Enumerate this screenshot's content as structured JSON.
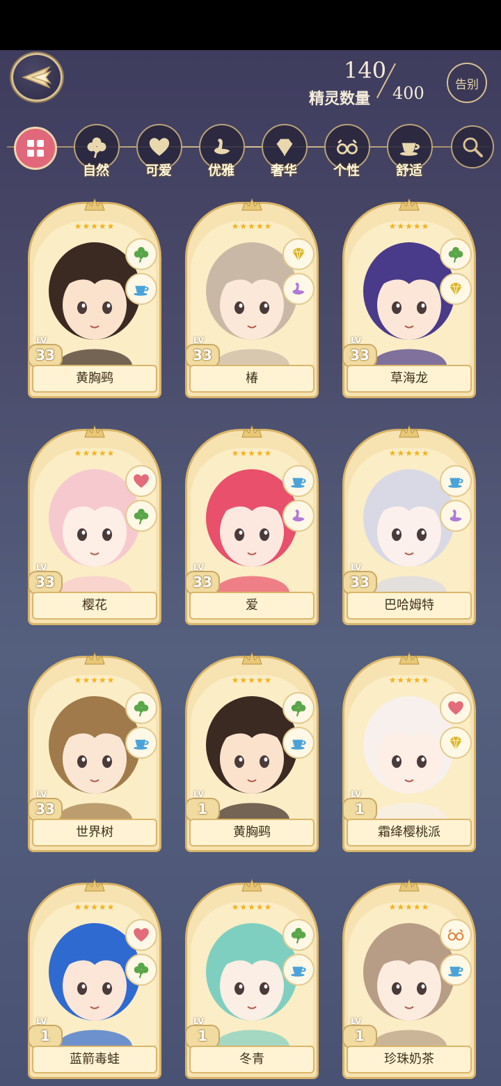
{
  "header": {
    "count_current": "140",
    "count_label": "精灵数量",
    "count_max": "400",
    "farewell_label": "告别"
  },
  "filters": [
    {
      "label": "自然",
      "icon": "clover-icon"
    },
    {
      "label": "可爱",
      "icon": "heart-icon"
    },
    {
      "label": "优雅",
      "icon": "swan-icon"
    },
    {
      "label": "奢华",
      "icon": "diamond-icon"
    },
    {
      "label": "个性",
      "icon": "glasses-icon"
    },
    {
      "label": "舒适",
      "icon": "teacup-icon"
    }
  ],
  "colors": {
    "clover": "#5aa64a",
    "heart": "#e36b7a",
    "swan": "#b07ad8",
    "diamond": "#d9b42a",
    "teacup": "#4aa3d8",
    "glasses": "#d98a4a"
  },
  "cards": [
    {
      "name": "黄胸鹀",
      "lv_label": "LV",
      "level": "33",
      "badges": [
        "clover-icon",
        "teacup-icon"
      ],
      "hair": "#3a2a22",
      "skin": "#fbe2cc"
    },
    {
      "name": "椿",
      "lv_label": "LV",
      "level": "33",
      "badges": [
        "diamond-icon",
        "swan-icon"
      ],
      "hair": "#c9b8a6",
      "skin": "#fbe8d8"
    },
    {
      "name": "草海龙",
      "lv_label": "LV",
      "level": "33",
      "badges": [
        "clover-icon",
        "diamond-icon"
      ],
      "hair": "#4a3a8a",
      "skin": "#fbe6d8"
    },
    {
      "name": "樱花",
      "lv_label": "LV",
      "level": "33",
      "badges": [
        "heart-icon",
        "clover-icon"
      ],
      "hair": "#f6c9cf",
      "skin": "#fdeee6"
    },
    {
      "name": "爱",
      "lv_label": "LV",
      "level": "33",
      "badges": [
        "teacup-icon",
        "swan-icon"
      ],
      "hair": "#e8506c",
      "skin": "#fde8e0"
    },
    {
      "name": "巴哈姆特",
      "lv_label": "LV",
      "level": "33",
      "badges": [
        "teacup-icon",
        "swan-icon"
      ],
      "hair": "#d9d9e6",
      "skin": "#fcf0ec"
    },
    {
      "name": "世界树",
      "lv_label": "LV",
      "level": "33",
      "badges": [
        "clover-icon",
        "teacup-icon"
      ],
      "hair": "#a07a4a",
      "skin": "#fbe6d4"
    },
    {
      "name": "黄胸鹀",
      "lv_label": "LV",
      "level": "1",
      "badges": [
        "clover-icon",
        "teacup-icon"
      ],
      "hair": "#3a2a22",
      "skin": "#fbe2cc"
    },
    {
      "name": "霜绛樱桃派",
      "lv_label": "LV",
      "level": "1",
      "badges": [
        "heart-icon",
        "diamond-icon"
      ],
      "hair": "#f8f0ec",
      "skin": "#fdeee6"
    },
    {
      "name": "蓝箭毒蛙",
      "lv_label": "LV",
      "level": "1",
      "badges": [
        "heart-icon",
        "clover-icon"
      ],
      "hair": "#2f6ad0",
      "skin": "#fbe6d8"
    },
    {
      "name": "冬青",
      "lv_label": "LV",
      "level": "1",
      "badges": [
        "clover-icon",
        "teacup-icon"
      ],
      "hair": "#7fcfc0",
      "skin": "#fbeee4"
    },
    {
      "name": "珍珠奶茶",
      "lv_label": "LV",
      "level": "1",
      "badges": [
        "glasses-icon",
        "teacup-icon"
      ],
      "hair": "#b79c86",
      "skin": "#fcece0"
    }
  ]
}
